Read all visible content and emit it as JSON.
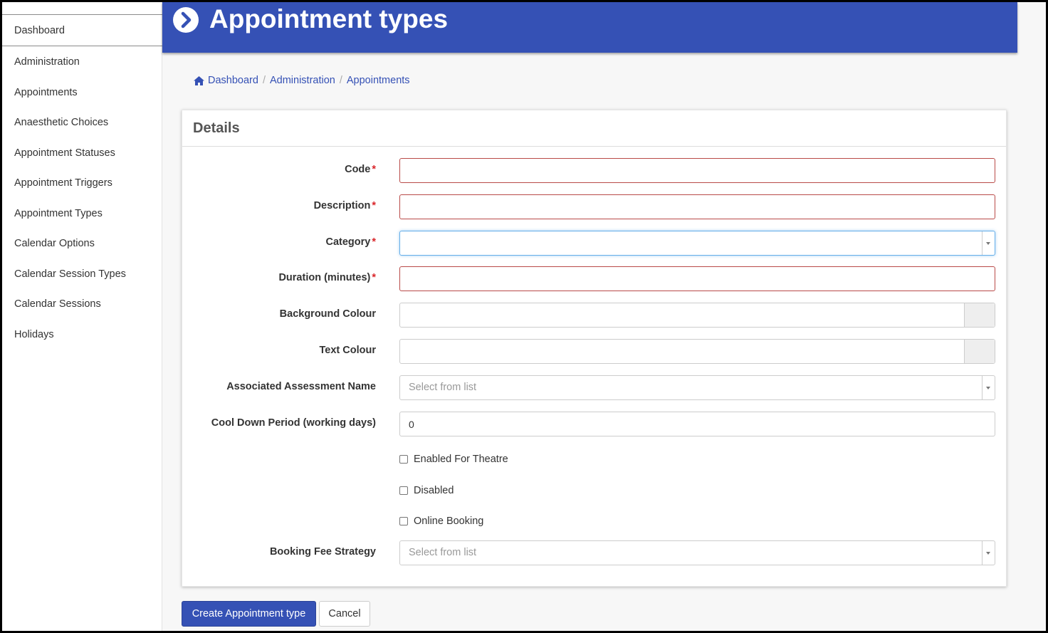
{
  "sidebar": {
    "items": [
      {
        "label": "Dashboard"
      },
      {
        "label": "Administration"
      },
      {
        "label": "Appointments"
      },
      {
        "label": "Anaesthetic Choices"
      },
      {
        "label": "Appointment Statuses"
      },
      {
        "label": "Appointment Triggers"
      },
      {
        "label": "Appointment Types"
      },
      {
        "label": "Calendar Options"
      },
      {
        "label": "Calendar Session Types"
      },
      {
        "label": "Calendar Sessions"
      },
      {
        "label": "Holidays"
      }
    ]
  },
  "header": {
    "title": "Appointment types",
    "icon": "chevron-right-circle-icon"
  },
  "breadcrumb": {
    "items": [
      "Dashboard",
      "Administration",
      "Appointments"
    ],
    "separator": "/"
  },
  "form": {
    "card_title": "Details",
    "required_marker": "*",
    "fields": {
      "code": {
        "label": "Code",
        "value": ""
      },
      "description": {
        "label": "Description",
        "value": ""
      },
      "category": {
        "label": "Category",
        "value": ""
      },
      "duration": {
        "label": "Duration (minutes)",
        "value": ""
      },
      "background_colour": {
        "label": "Background Colour",
        "value": ""
      },
      "text_colour": {
        "label": "Text Colour",
        "value": ""
      },
      "assessment": {
        "label": "Associated Assessment Name",
        "placeholder": "Select from list"
      },
      "cool_down": {
        "label": "Cool Down Period (working days)",
        "value": "0"
      },
      "enabled_theatre": {
        "label": "Enabled For Theatre",
        "checked": false
      },
      "disabled": {
        "label": "Disabled",
        "checked": false
      },
      "online_booking": {
        "label": "Online Booking",
        "checked": false
      },
      "booking_fee": {
        "label": "Booking Fee Strategy",
        "placeholder": "Select from list"
      }
    }
  },
  "actions": {
    "create_label": "Create Appointment type",
    "cancel_label": "Cancel"
  },
  "colors": {
    "brand": "#3551b5",
    "error_border": "#b94a48",
    "required": "#d9262b"
  }
}
